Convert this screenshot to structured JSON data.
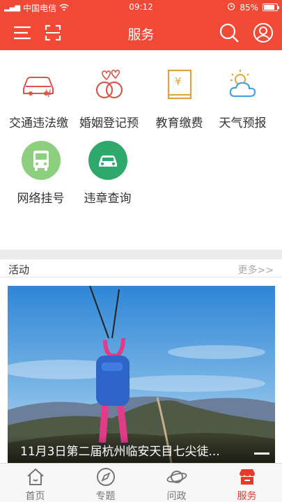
{
  "status_bar": {
    "carrier": "中国电信",
    "time": "09:12",
    "battery": "85%"
  },
  "header": {
    "title": "服务"
  },
  "services": [
    {
      "label": "交通违法缴",
      "icon": "car-yen-icon"
    },
    {
      "label": "婚姻登记预",
      "icon": "hearts-rings-icon"
    },
    {
      "label": "教育缴费",
      "icon": "book-yen-icon"
    },
    {
      "label": "天气预报",
      "icon": "weather-sun-cloud-icon"
    },
    {
      "label": "网络挂号",
      "icon": "bus-icon"
    },
    {
      "label": "违章查询",
      "icon": "car-icon"
    }
  ],
  "activities": {
    "title": "活动",
    "more": "更多>>",
    "banner_caption": "11月3日第二届杭州临安天目七尖徒..."
  },
  "tabbar": [
    {
      "label": "首页",
      "icon": "home-icon"
    },
    {
      "label": "专题",
      "icon": "compass-icon"
    },
    {
      "label": "问政",
      "icon": "planet-icon"
    },
    {
      "label": "服务",
      "icon": "store-icon",
      "active": true
    }
  ],
  "colors": {
    "brand_red": "#f04a36",
    "active_tab": "#e8392a"
  }
}
